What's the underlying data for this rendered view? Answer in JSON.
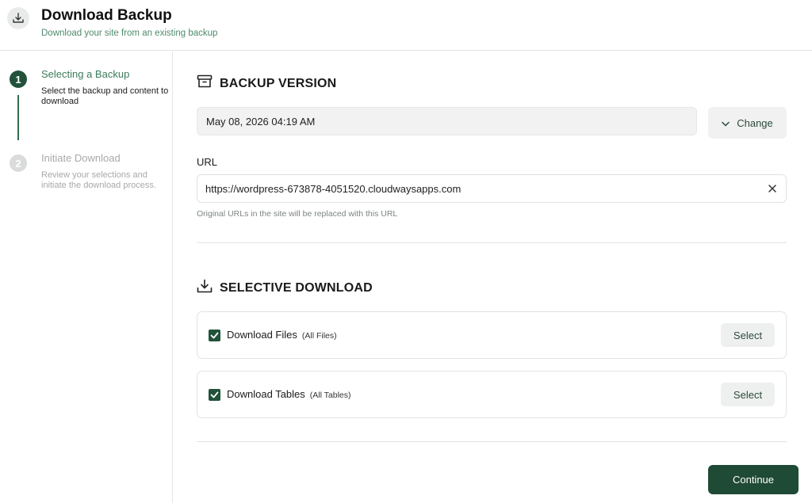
{
  "header": {
    "title": "Download Backup",
    "subtitle": "Download your site from an existing backup",
    "icon": "download-icon"
  },
  "steps": [
    {
      "number": "1",
      "title": "Selecting a Backup",
      "description": "Select the backup and content to download",
      "state": "active"
    },
    {
      "number": "2",
      "title": "Initiate Download",
      "description": "Review your selections and initiate the download process.",
      "state": "inactive"
    }
  ],
  "backup_version": {
    "heading": "BACKUP VERSION",
    "icon": "archive-box-icon",
    "date_value": "May 08, 2026 04:19 AM",
    "change_label": "Change"
  },
  "url": {
    "label": "URL",
    "value": "https://wordpress-673878-4051520.cloudwaysapps.com",
    "hint": "Original URLs in the site will be replaced with this URL"
  },
  "selective_download": {
    "heading": "SELECTIVE DOWNLOAD",
    "icon": "download-tray-icon",
    "options": [
      {
        "label": "Download Files",
        "sub": "(All Files)",
        "checked": true,
        "button": "Select"
      },
      {
        "label": "Download Tables",
        "sub": "(All Tables)",
        "checked": true,
        "button": "Select"
      }
    ]
  },
  "continue_label": "Continue",
  "colors": {
    "accent": "#22523a",
    "accent_light": "#3d7a5a",
    "button_bg": "#f0f1f0"
  }
}
